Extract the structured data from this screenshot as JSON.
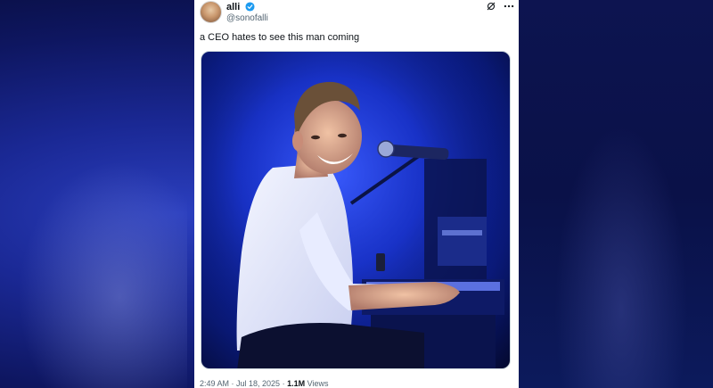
{
  "tweet": {
    "author_name": "alli",
    "author_handle": "@sonofalli",
    "verified": true,
    "text": "a CEO hates to see this man coming",
    "timestamp": "2:49 AM · Jul 18, 2025",
    "separator": "·",
    "views_count": "1.1M",
    "views_label": "Views"
  },
  "icons": {
    "verified": "verified-badge-icon",
    "grok": "grok-icon",
    "more": "more-options-icon"
  },
  "colors": {
    "verified_blue": "#1d9bf0",
    "stage_blue": "#1630c4",
    "text_primary": "#0f1419",
    "text_secondary": "#536471"
  }
}
